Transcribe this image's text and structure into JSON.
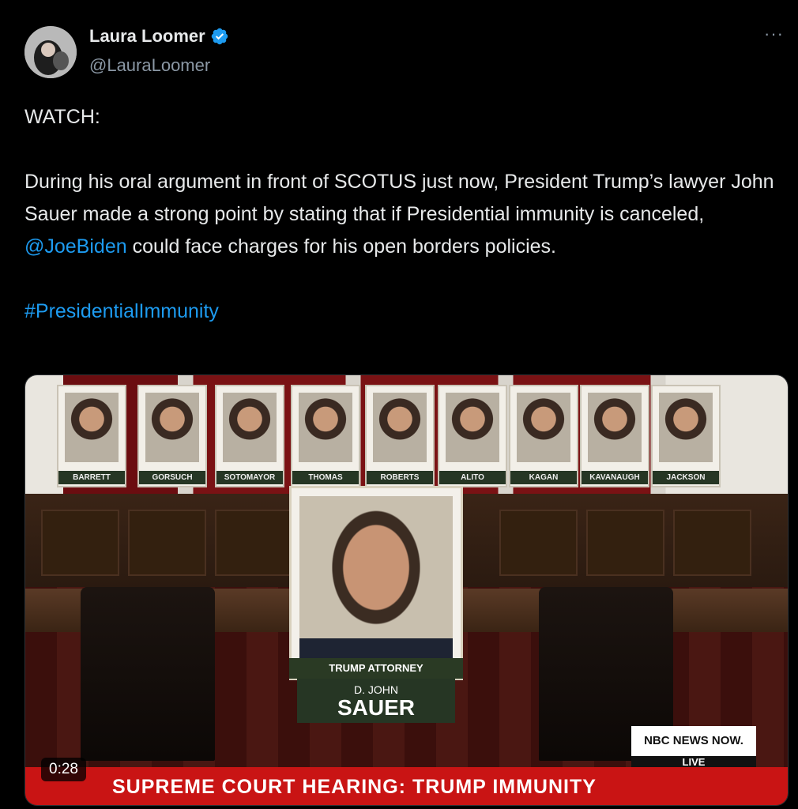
{
  "author": {
    "display_name": "Laura Loomer",
    "handle": "@LauraLoomer",
    "verified": true
  },
  "more_menu_label": "···",
  "tweet": {
    "line1": "WATCH:",
    "body_part1": "During his oral argument in front of SCOTUS just now, President Trump’s lawyer John Sauer made a strong point by stating that if Presidential immunity is canceled, ",
    "mention": "@JoeBiden",
    "body_part2": " could face charges for his open borders policies.",
    "hashtag": "#PresidentialImmunity"
  },
  "video": {
    "duration": "0:28",
    "justices": [
      "BARRETT",
      "GORSUCH",
      "SOTOMAYOR",
      "THOMAS",
      "ROBERTS",
      "ALITO",
      "KAGAN",
      "KAVANAUGH",
      "JACKSON"
    ],
    "attorney_label": "TRUMP ATTORNEY",
    "attorney_first": "D. JOHN",
    "attorney_last": "SAUER",
    "network_badge": "NBC NEWS NOW.",
    "live_label": "LIVE",
    "ticker": "SUPREME COURT HEARING: TRUMP IMMUNITY"
  },
  "colors": {
    "link": "#1d9bf0",
    "verified_badge": "#1d9bf0",
    "ticker": "#c91414"
  }
}
